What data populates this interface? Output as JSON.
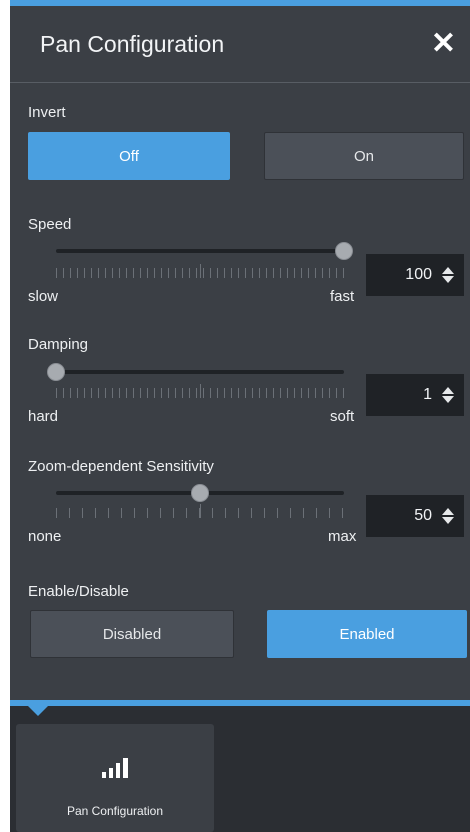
{
  "panel": {
    "title": "Pan Configuration"
  },
  "invert": {
    "label": "Invert",
    "off_label": "Off",
    "on_label": "On",
    "selected": "Off"
  },
  "speed": {
    "label": "Speed",
    "min_label": "slow",
    "max_label": "fast",
    "value": "100",
    "level": 1.0
  },
  "damping": {
    "label": "Damping",
    "min_label": "hard",
    "max_label": "soft",
    "value": "1",
    "level": 0.0
  },
  "zoom_sensitivity": {
    "label": "Zoom-dependent Sensitivity",
    "min_label": "none",
    "max_label": "max",
    "value": "50",
    "level": 0.5
  },
  "enable": {
    "label": "Enable/Disable",
    "disabled_label": "Disabled",
    "enabled_label": "Enabled",
    "selected": "Enabled"
  },
  "dock": {
    "tile_label": "Pan Configuration",
    "tile_icon": "signal-bars-icon"
  },
  "colors": {
    "accent": "#4a9fe0",
    "panel_bg": "#3b3f45",
    "page_bg": "#2b2e33"
  }
}
